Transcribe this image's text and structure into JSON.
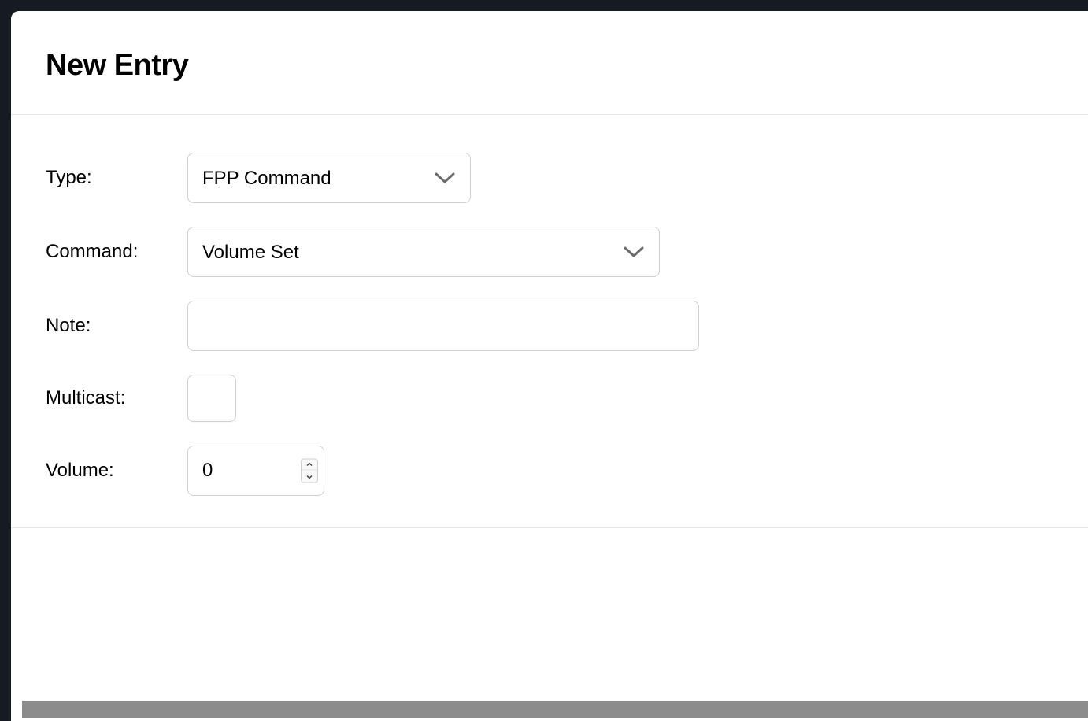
{
  "modal": {
    "title": "New Entry"
  },
  "form": {
    "type": {
      "label": "Type:",
      "value": "FPP Command"
    },
    "command": {
      "label": "Command:",
      "value": "Volume Set"
    },
    "note": {
      "label": "Note:",
      "value": ""
    },
    "multicast": {
      "label": "Multicast:",
      "checked": false
    },
    "volume": {
      "label": "Volume:",
      "value": "0"
    }
  }
}
